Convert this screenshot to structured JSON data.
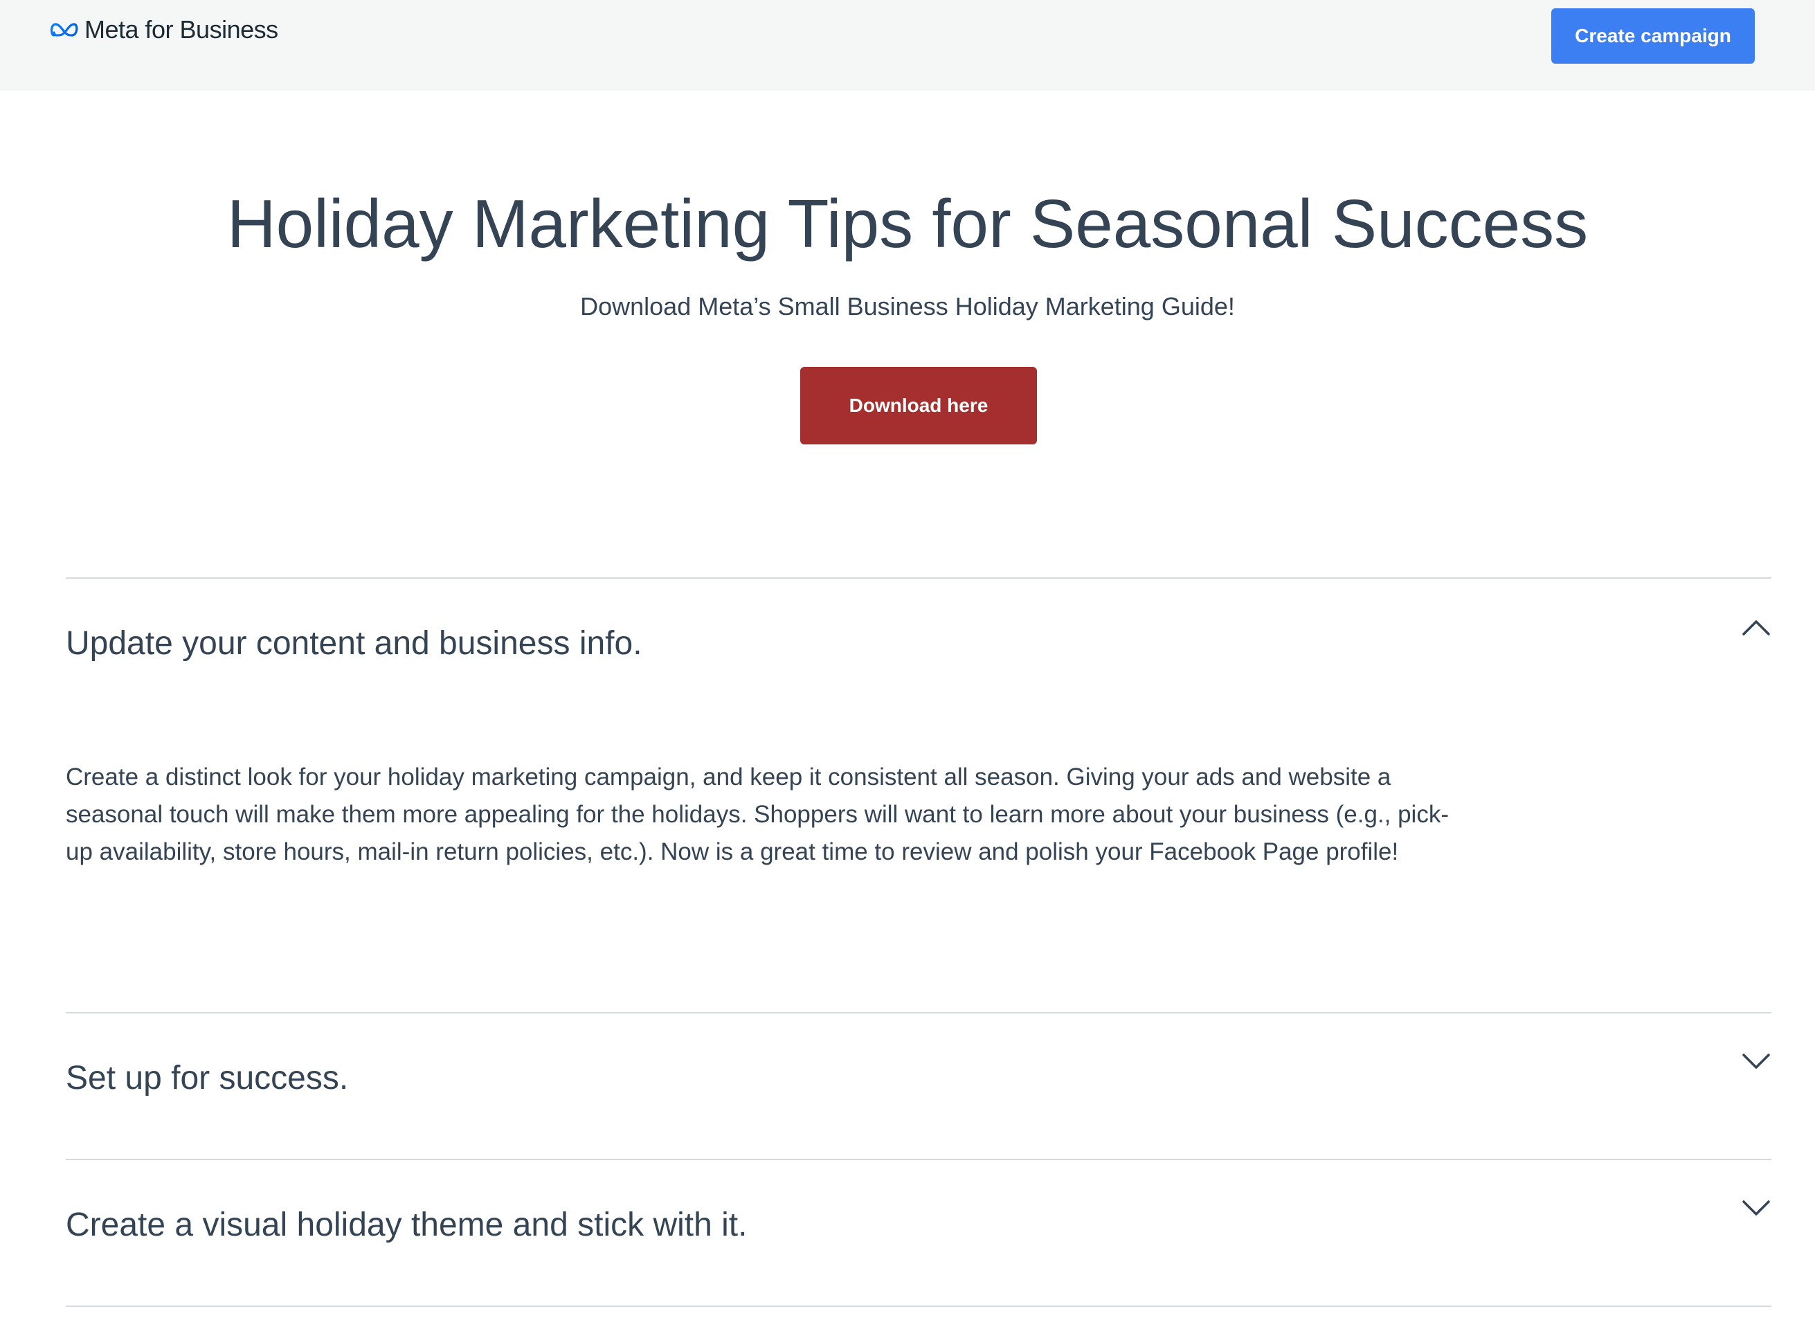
{
  "header": {
    "logo_text": "Meta for Business",
    "logo_icon": "meta-infinity-icon",
    "create_campaign_label": "Create campaign",
    "brand_color": "#3b7ff2"
  },
  "hero": {
    "title": "Holiday Marketing Tips for Seasonal Success",
    "subtitle": "Download Meta’s Small Business Holiday Marketing Guide!",
    "download_label": "Download here",
    "download_color": "#a52f2f"
  },
  "accordion": {
    "items": [
      {
        "title": "Update your content and business info.",
        "expanded": true,
        "icon": "chevron-up-icon",
        "body": "Create a distinct look for your holiday marketing campaign, and keep it consistent all season. Giving your ads and website a seasonal touch will make them more appealing for the holidays. Shoppers will want to learn more about your business (e.g., pick-up availability, store hours, mail-in return policies, etc.). Now is a great time to review and polish your Facebook Page profile!"
      },
      {
        "title": "Set up for success.",
        "expanded": false,
        "icon": "chevron-down-icon"
      },
      {
        "title": "Create a visual holiday theme and stick with it.",
        "expanded": false,
        "icon": "chevron-down-icon"
      }
    ]
  }
}
